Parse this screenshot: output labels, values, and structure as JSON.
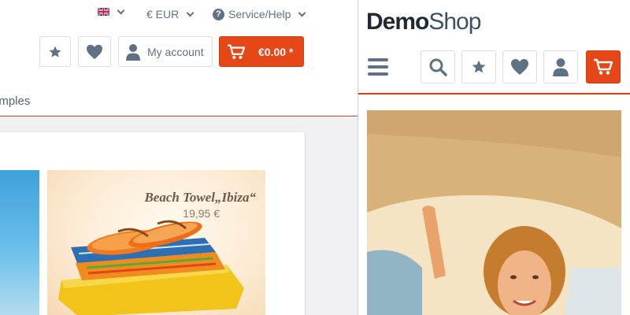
{
  "desktop": {
    "topbar": {
      "language_flag": "uk-flag",
      "currency": "€ EUR",
      "service_help": "Service/Help"
    },
    "actions": {
      "star_icon": "star-icon",
      "heart_icon": "heart-icon",
      "account_label": "My account",
      "cart_total": "€0.00 *"
    },
    "nav": {
      "partial_link": "amples"
    },
    "teaser": {
      "towel_title": "Beach Towel„Ibiza“",
      "towel_price": "19,95 €"
    }
  },
  "mobile": {
    "logo": {
      "part1": "Demo",
      "part2": "Shop"
    },
    "icons": [
      "menu-icon",
      "search-icon",
      "star-icon",
      "heart-icon",
      "account-icon",
      "cart-icon"
    ]
  },
  "colors": {
    "accent": "#e54717",
    "text": "#5f7285",
    "border": "#dadae5",
    "gray_bg": "#f0f0f4"
  }
}
